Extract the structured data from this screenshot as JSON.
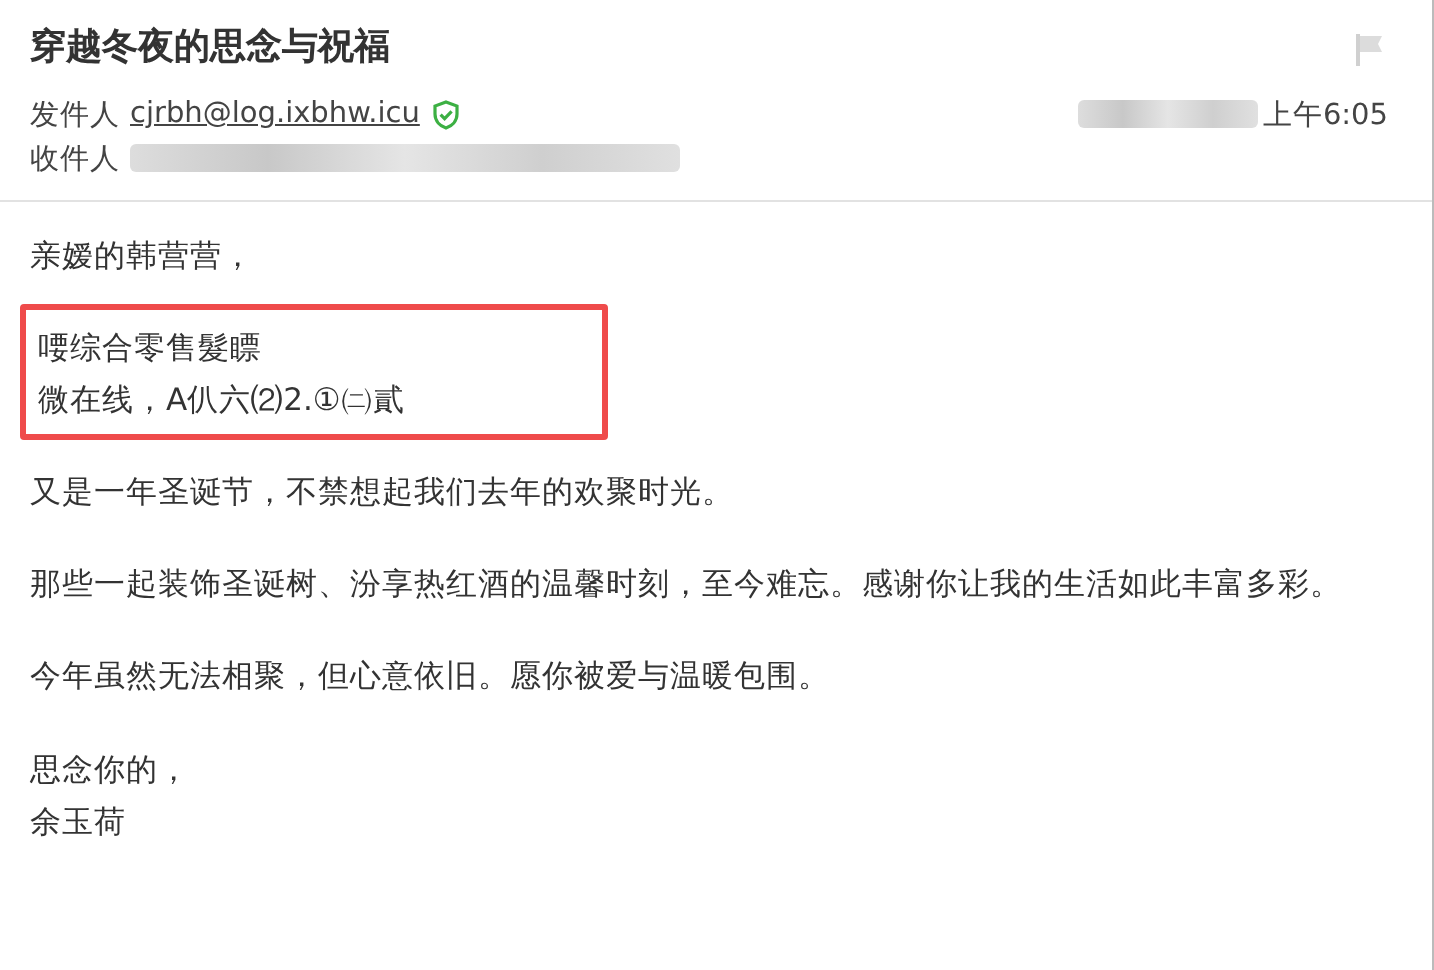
{
  "email": {
    "subject": "穿越冬夜的思念与祝福",
    "flagged": false,
    "sender": {
      "label": "发件人",
      "address": "cjrbh@log.ixbhw.icu",
      "verified": true
    },
    "time": "上午6:05",
    "recipient": {
      "label": "收件人"
    }
  },
  "body": {
    "greeting": "亲嫒的韩营营，",
    "highlight": {
      "lines": [
        "喓综合零售髮瞟",
        "微在线，A仈六⑵2.①㈡貳"
      ]
    },
    "paragraphs": [
      "又是一年圣诞节，不禁想起我们去年的欢聚时光。",
      "那些一起装饰圣诞树、汾享热红酒的温馨时刻，至今难忘。感谢你让我的生活如此丰富多彩。",
      "今年虽然无法相聚，但心意依旧。愿你被爱与温暖包围。"
    ],
    "closing": "思念你的，",
    "signature": "余玉荷"
  }
}
